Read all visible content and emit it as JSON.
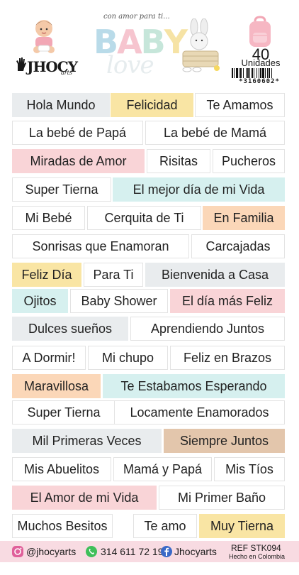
{
  "header": {
    "brand": {
      "name": "JHOCY",
      "sub": "arts"
    },
    "title": {
      "script": "con amor para ti...",
      "main": "BABY",
      "sub": "love"
    },
    "count": {
      "value": "40",
      "label": "Unidades"
    },
    "barcode_number": "*3160602*"
  },
  "colors": {
    "gray": "#e9ecee",
    "yellow": "#f9e5a4",
    "pink": "#f9d4d7",
    "mint": "#d6f0ef",
    "peach": "#fbd7b8",
    "tan": "#e3c6ac",
    "white": "#ffffff",
    "footer": "#f8dbe2"
  },
  "stickers": [
    {
      "text": "Hola Mundo",
      "color": "gray"
    },
    {
      "text": "Felicidad",
      "color": "yellow"
    },
    {
      "text": "Te Amamos",
      "color": "white"
    },
    {
      "text": "La bebé de Papá",
      "color": "white"
    },
    {
      "text": "La bebé de Mamá",
      "color": "white"
    },
    {
      "text": "Miradas de Amor",
      "color": "pink"
    },
    {
      "text": "Risitas",
      "color": "white"
    },
    {
      "text": "Pucheros",
      "color": "white"
    },
    {
      "text": "Super Tierna",
      "color": "white"
    },
    {
      "text": "El mejor día de mi Vida",
      "color": "mint"
    },
    {
      "text": "Mi Bebé",
      "color": "white"
    },
    {
      "text": "Cerquita de Ti",
      "color": "white"
    },
    {
      "text": "En Familia",
      "color": "peach"
    },
    {
      "text": "Sonrisas que Enamoran",
      "color": "white"
    },
    {
      "text": "Carcajadas",
      "color": "white"
    },
    {
      "text": "Feliz Día",
      "color": "yellow"
    },
    {
      "text": "Para Ti",
      "color": "white"
    },
    {
      "text": "Bienvenida a Casa",
      "color": "gray"
    },
    {
      "text": "Ojitos",
      "color": "mint"
    },
    {
      "text": "Baby Shower",
      "color": "white"
    },
    {
      "text": "El día más Feliz",
      "color": "pink"
    },
    {
      "text": "Dulces sueños",
      "color": "gray"
    },
    {
      "text": "Aprendiendo Juntos",
      "color": "white"
    },
    {
      "text": "A Dormir!",
      "color": "white"
    },
    {
      "text": "Mi chupo",
      "color": "white"
    },
    {
      "text": "Feliz en Brazos",
      "color": "white"
    },
    {
      "text": "Maravillosa",
      "color": "peach"
    },
    {
      "text": "Te Estabamos Esperando",
      "color": "mint"
    },
    {
      "text": "Super Tierna",
      "color": "white"
    },
    {
      "text": "Locamente Enamorados",
      "color": "white"
    },
    {
      "text": "Mil Primeras Veces",
      "color": "gray"
    },
    {
      "text": "Siempre Juntos",
      "color": "tan"
    },
    {
      "text": "Mis Abuelitos",
      "color": "white"
    },
    {
      "text": "Mamá y Papá",
      "color": "white"
    },
    {
      "text": "Mis Tíos",
      "color": "white"
    },
    {
      "text": "El Amor de mi Vida",
      "color": "pink"
    },
    {
      "text": "Mi Primer Baño",
      "color": "white"
    },
    {
      "text": "Muchos Besitos",
      "color": "white"
    },
    {
      "text": "Te amo",
      "color": "white"
    },
    {
      "text": "Muy Tierna",
      "color": "yellow"
    }
  ],
  "footer": {
    "instagram": "@jhocyarts",
    "whatsapp": "314 611 72 19",
    "facebook": "Jhocyarts",
    "ref": "REF  STK094",
    "made_in": "Hecho en Colombia"
  }
}
